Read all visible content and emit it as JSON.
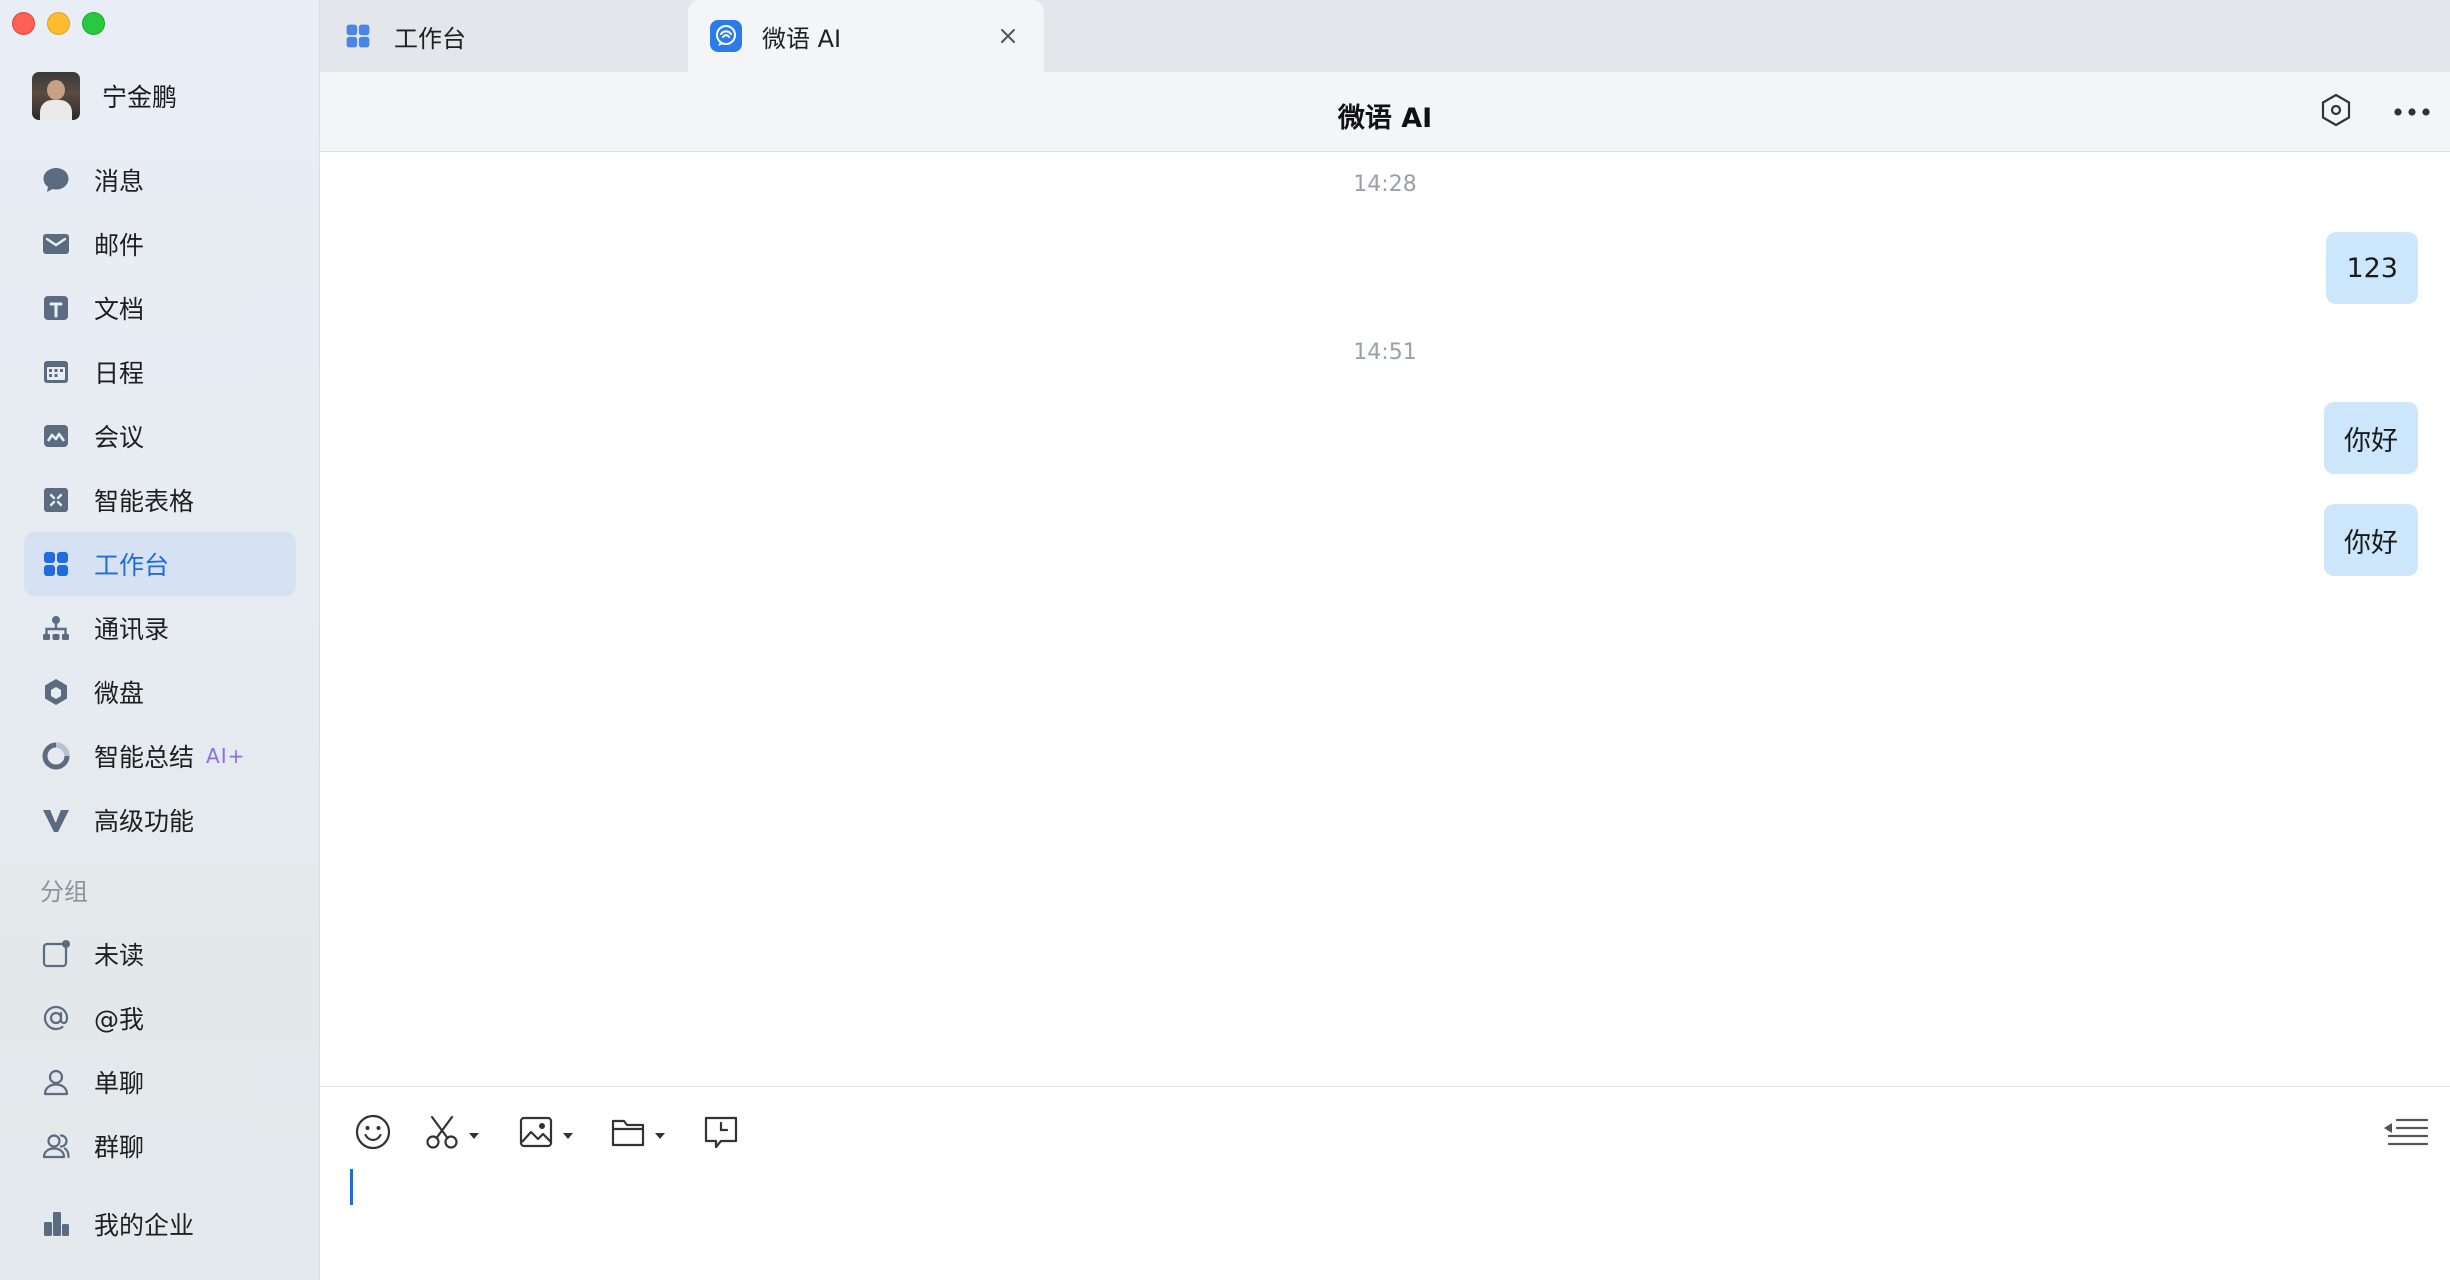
{
  "app": {
    "accent": "#1f6cdf",
    "bubble_color": "#cce6fb"
  },
  "profile": {
    "name": "宁金鹏"
  },
  "nav": {
    "items": [
      {
        "label": "消息",
        "icon": "message-icon"
      },
      {
        "label": "邮件",
        "icon": "mail-icon"
      },
      {
        "label": "文档",
        "icon": "doc-icon"
      },
      {
        "label": "日程",
        "icon": "calendar-icon"
      },
      {
        "label": "会议",
        "icon": "meeting-icon"
      },
      {
        "label": "智能表格",
        "icon": "smart-table-icon"
      },
      {
        "label": "工作台",
        "icon": "workbench-icon",
        "active": true
      },
      {
        "label": "通讯录",
        "icon": "contacts-icon"
      },
      {
        "label": "微盘",
        "icon": "drive-icon"
      },
      {
        "label": "智能总结",
        "icon": "summary-icon",
        "badge": "AI+"
      },
      {
        "label": "高级功能",
        "icon": "advanced-icon"
      }
    ],
    "group_title": "分组",
    "groups": [
      {
        "label": "未读",
        "icon": "unread-icon"
      },
      {
        "label": "@我",
        "icon": "at-icon"
      },
      {
        "label": "单聊",
        "icon": "single-chat-icon"
      },
      {
        "label": "群聊",
        "icon": "group-chat-icon"
      }
    ],
    "bottom": {
      "label": "我的企业",
      "icon": "enterprise-icon"
    }
  },
  "tabs": [
    {
      "label": "工作台",
      "icon": "workbench-icon"
    },
    {
      "label": "微语 AI",
      "icon": "weiyu-ai-icon",
      "active": true
    }
  ],
  "header": {
    "title": "微语 AI"
  },
  "messages": [
    {
      "type": "time",
      "text": "14:28"
    },
    {
      "type": "sent",
      "text": "123"
    },
    {
      "type": "time",
      "text": "14:51"
    },
    {
      "type": "sent",
      "text": "你好"
    },
    {
      "type": "sent",
      "text": "你好"
    }
  ],
  "composer": {
    "tools": [
      "emoji-icon",
      "screenshot-icon",
      "image-icon",
      "file-icon",
      "schedule-message-icon"
    ],
    "value": ""
  }
}
